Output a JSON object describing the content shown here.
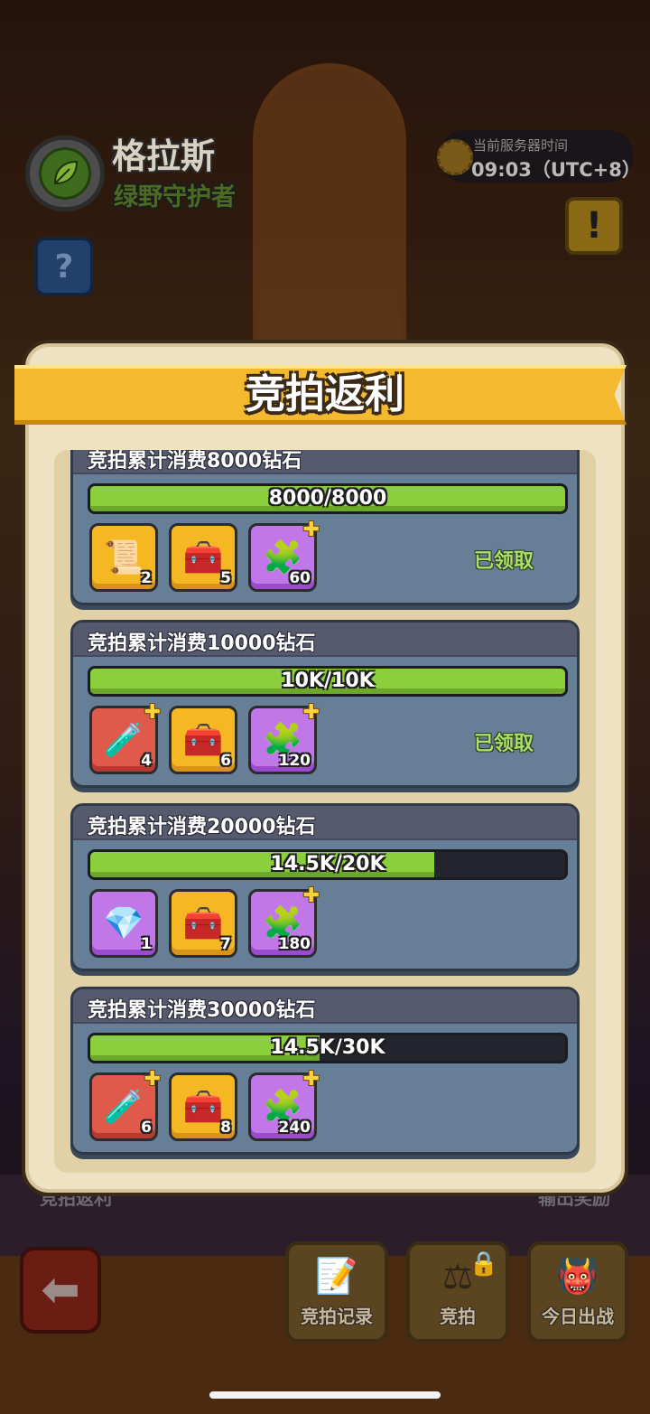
{
  "hero": {
    "name": "格拉斯",
    "title": "绿野守护者"
  },
  "server": {
    "label": "当前服务器时间",
    "time": "09:03（UTC+8）"
  },
  "popup": {
    "title": "竞拍返利",
    "tiers": [
      {
        "title": "竞拍累计消费8000钻石",
        "progress_text": "8000/8000",
        "progress": 1.0,
        "rewards": [
          {
            "icon": "scroll-icon",
            "glyph": "📜",
            "color": "yellow",
            "count": "2",
            "plus": false
          },
          {
            "icon": "golden-chest-icon",
            "glyph": "🧰",
            "color": "yellow",
            "count": "5",
            "plus": false
          },
          {
            "icon": "puzzle-piece-icon",
            "glyph": "🧩",
            "color": "purple",
            "count": "60",
            "plus": true
          }
        ],
        "status": "已领取"
      },
      {
        "title": "竞拍累计消费10000钻石",
        "progress_text": "10K/10K",
        "progress": 1.0,
        "rewards": [
          {
            "icon": "red-potion-shard-icon",
            "glyph": "🧪",
            "color": "red",
            "count": "4",
            "plus": true
          },
          {
            "icon": "golden-chest-icon",
            "glyph": "🧰",
            "color": "yellow",
            "count": "6",
            "plus": false
          },
          {
            "icon": "puzzle-piece-icon",
            "glyph": "🧩",
            "color": "purple",
            "count": "120",
            "plus": true
          }
        ],
        "status": "已领取"
      },
      {
        "title": "竞拍累计消费20000钻石",
        "progress_text": "14.5K/20K",
        "progress": 0.725,
        "rewards": [
          {
            "icon": "gem-chest-icon",
            "glyph": "💎",
            "color": "purple",
            "count": "1",
            "plus": false
          },
          {
            "icon": "golden-chest-icon",
            "glyph": "🧰",
            "color": "yellow",
            "count": "7",
            "plus": false
          },
          {
            "icon": "puzzle-piece-icon",
            "glyph": "🧩",
            "color": "purple",
            "count": "180",
            "plus": true
          }
        ],
        "status": ""
      },
      {
        "title": "竞拍累计消费30000钻石",
        "progress_text": "14.5K/30K",
        "progress": 0.483,
        "rewards": [
          {
            "icon": "red-potion-shard-icon",
            "glyph": "🧪",
            "color": "red",
            "count": "6",
            "plus": true
          },
          {
            "icon": "golden-chest-icon",
            "glyph": "🧰",
            "color": "yellow",
            "count": "8",
            "plus": false
          },
          {
            "icon": "puzzle-piece-icon",
            "glyph": "🧩",
            "color": "purple",
            "count": "240",
            "plus": true
          }
        ],
        "status": ""
      }
    ]
  },
  "underlay": {
    "left_label": "竞拍返利",
    "right_label": "输出奖励"
  },
  "bottom_bar": {
    "tabs": [
      {
        "name": "tab-auction-record",
        "label": "竞拍记录",
        "icon": "document-icon",
        "glyph": "📝",
        "locked": false
      },
      {
        "name": "tab-auction",
        "label": "竞拍",
        "icon": "gavel-icon",
        "glyph": "⚖",
        "locked": true
      },
      {
        "name": "tab-today-battle",
        "label": "今日出战",
        "icon": "monster-head-icon",
        "glyph": "👹",
        "locked": false
      }
    ]
  },
  "colors": {
    "accent": "#f4b92e",
    "progress": "#8ccf3c",
    "claimed": "#a8e06a",
    "card": "#667f97"
  }
}
